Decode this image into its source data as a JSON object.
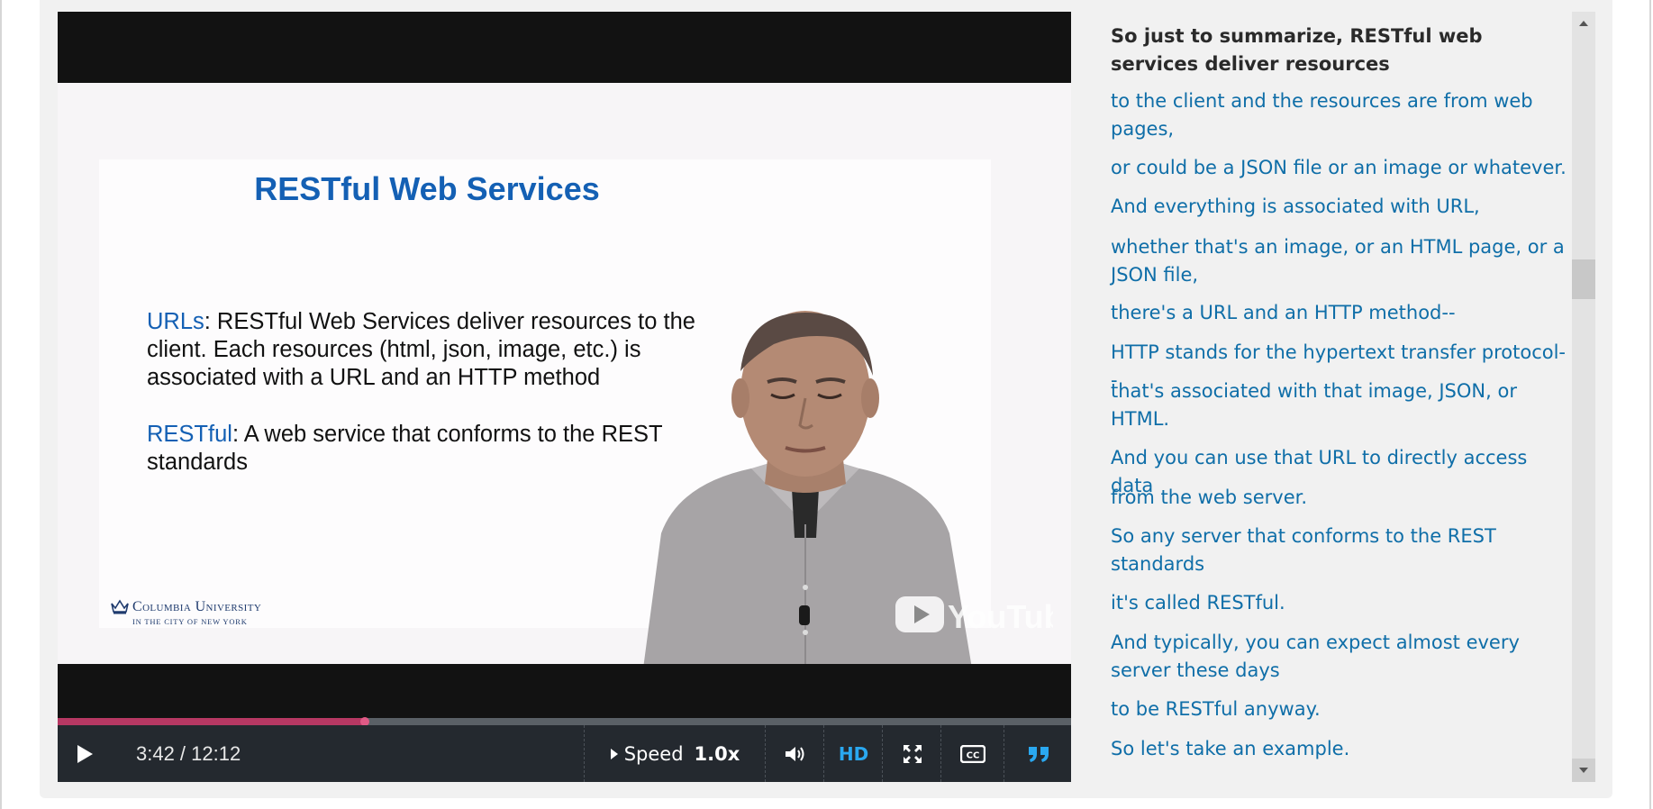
{
  "video": {
    "slide": {
      "title": "RESTful Web Services",
      "paragraph1_term": "URLs",
      "paragraph1_text": ": RESTful Web Services deliver resources to the client. Each resources (html, json, image, etc.) is associated with a URL and an HTTP method",
      "paragraph2_term": "RESTful",
      "paragraph2_text": ": A web service that conforms to the REST standards",
      "logo_name": "Columbia University",
      "logo_sub": "IN THE CITY OF NEW YORK"
    },
    "watermark": "YouTube",
    "progress_fraction": 0.303,
    "controls": {
      "time": "3:42 / 12:12",
      "speed_label": "Speed",
      "speed_value": "1.0x",
      "hd_label": "HD"
    },
    "colors": {
      "progress_played": "#b73863",
      "accent": "#2aa8f0",
      "transcript_link": "#0f6ea8"
    }
  },
  "transcript": {
    "lines": [
      "So just to summarize, RESTful web services deliver resources",
      "to the client and the resources are from web pages,",
      "or could be a JSON file or an image or whatever.",
      "And everything is associated with URL,",
      "whether that's an image, or an HTML page, or a JSON file,",
      "there's a URL and an HTTP method--",
      "HTTP stands for the hypertext transfer protocol--",
      "that's associated with that image, JSON, or HTML.",
      "And you can use that URL to directly access data",
      "from the web server.",
      "So any server that conforms to the REST standards",
      "it's called RESTful.",
      "And typically, you can expect almost every server these days",
      "to be RESTful anyway.",
      "So let's take an example."
    ]
  }
}
